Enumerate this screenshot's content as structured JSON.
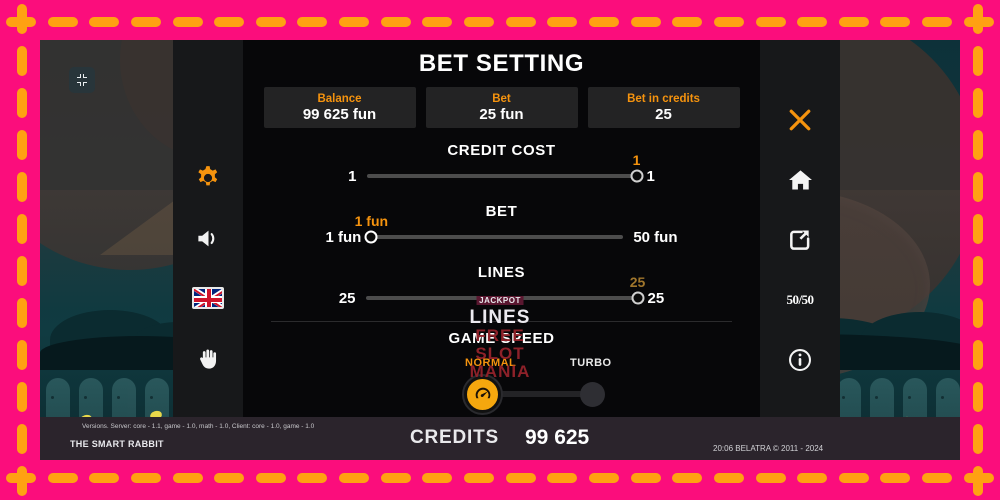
{
  "window": {
    "fullscreen_icon": "collapse-fullscreen-icon"
  },
  "left_rail": {
    "items": [
      {
        "name": "settings",
        "icon": "gear-icon",
        "active": true
      },
      {
        "name": "sound",
        "icon": "speaker-icon",
        "active": false
      },
      {
        "name": "language",
        "icon": "uk-flag-icon",
        "active": false
      },
      {
        "name": "hand",
        "icon": "hand-icon",
        "active": false
      }
    ]
  },
  "right_rail": {
    "items": [
      {
        "name": "close",
        "icon": "close-x-icon",
        "label": ""
      },
      {
        "name": "home",
        "icon": "home-icon",
        "label": ""
      },
      {
        "name": "exit",
        "icon": "external-link-icon",
        "label": ""
      },
      {
        "name": "odds",
        "icon": "fifty-fifty-icon",
        "label": "50/50"
      },
      {
        "name": "info",
        "icon": "info-circle-icon",
        "label": ""
      }
    ]
  },
  "panel": {
    "title": "BET SETTING",
    "info_boxes": [
      {
        "label": "Balance",
        "value": "99 625 fun"
      },
      {
        "label": "Bet",
        "value": "25 fun"
      },
      {
        "label": "Bet in credits",
        "value": "25"
      }
    ],
    "sliders": [
      {
        "title": "CREDIT COST",
        "min_label": "1",
        "max_label": "1",
        "bubble": "1",
        "bubble_dim": false,
        "thumb_percent": 100,
        "thumb_style": "grey"
      },
      {
        "title": "BET",
        "min_label": "1 fun",
        "max_label": "50 fun",
        "bubble": "1 fun",
        "bubble_dim": false,
        "thumb_percent": 0,
        "thumb_style": "white"
      },
      {
        "title": "LINES",
        "min_label": "25",
        "max_label": "25",
        "bubble": "25",
        "bubble_dim": true,
        "thumb_percent": 100,
        "thumb_style": "grey"
      }
    ],
    "game_speed": {
      "title": "GAME SPEED",
      "normal_label": "NORMAL",
      "turbo_label": "TURBO",
      "selected": "NORMAL",
      "icon": "speedometer-icon"
    }
  },
  "watermark": {
    "jackpot": "JACKPOT",
    "lines": "LINES",
    "line2": "FREE",
    "line3": "SLOT",
    "line4": "MANIA"
  },
  "footer": {
    "versions": "Versions. Server: core - 1.1, game - 1.0, math - 1.0, Client: core - 1.0, game - 1.0",
    "brand": "THE SMART RABBIT",
    "credits_label": "CREDITS",
    "credits_value": "99 625",
    "copyright": "20:06  BELATRA © 2011 - 2024"
  },
  "colors": {
    "accent_orange": "#f5930e",
    "frame_pink": "#fb0d7c",
    "frame_dash": "#ffa112",
    "panel_dark": "#070709",
    "rail_dark": "#17181a"
  }
}
